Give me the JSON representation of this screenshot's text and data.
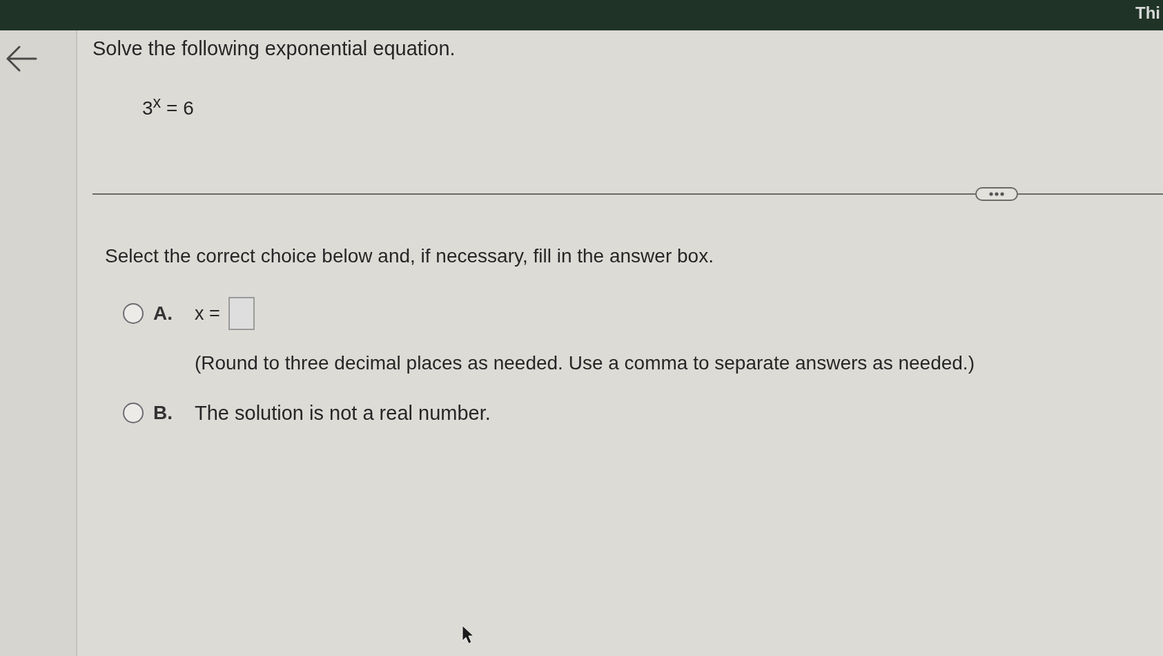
{
  "header": {
    "text": "Thi"
  },
  "question": {
    "instruction": "Solve the following exponential equation.",
    "equation": "3$^{x}$ = 6"
  },
  "prompt": "Select the correct choice below and, if necessary, fill in the answer box.",
  "choices": [
    {
      "letter": "A.",
      "kind": "answer",
      "text": "x =",
      "note": "(Round to three decimal places as needed. Use a comma to separate answers as needed.)",
      "selected": false
    },
    {
      "letter": "B.",
      "kind": "statement",
      "text": "The solution is not a real number.",
      "selected": false
    }
  ]
}
